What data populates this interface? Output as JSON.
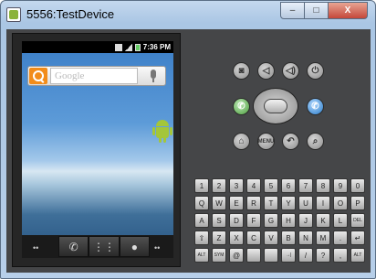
{
  "window": {
    "title": "5556:TestDevice",
    "min_symbol": "–",
    "max_symbol": "□",
    "close_symbol": "X"
  },
  "status_bar": {
    "time": "7:36 PM"
  },
  "home": {
    "search_placeholder": "Google",
    "dock": {
      "left_dots": "••",
      "right_dots": "••",
      "phone_icon": "✆",
      "apps_icon": "⋮⋮",
      "browser_icon": "●"
    }
  },
  "controls": {
    "camera_icon": "◙",
    "volume_down_icon": "◁",
    "volume_up_icon": "◁)",
    "power_icon": "⏻",
    "call_icon": "✆",
    "end_call_icon": "✆",
    "home_icon": "⌂",
    "menu_label": "MENU",
    "back_icon": "↶",
    "search_icon": "⌕"
  },
  "keyboard": {
    "row1": [
      "1",
      "2",
      "3",
      "4",
      "5",
      "6",
      "7",
      "8",
      "9",
      "0"
    ],
    "row2": [
      "Q",
      "W",
      "E",
      "R",
      "T",
      "Y",
      "U",
      "I",
      "O",
      "P"
    ],
    "row3": [
      "A",
      "S",
      "D",
      "F",
      "G",
      "H",
      "J",
      "K",
      "L",
      "DEL"
    ],
    "row4": [
      "⇧",
      "Z",
      "X",
      "C",
      "V",
      "B",
      "N",
      "M",
      ".",
      "↵"
    ],
    "row5": [
      "ALT",
      "SYM",
      "@",
      "",
      "",
      "→|",
      "/",
      "?",
      ",",
      "ALT"
    ]
  },
  "colors": {
    "skin": "#454648",
    "search_orange": "#f28c1a",
    "android_green": "#a4c639",
    "call_green": "#4c9e3e",
    "end_call_blue": "#2a7bc8"
  }
}
